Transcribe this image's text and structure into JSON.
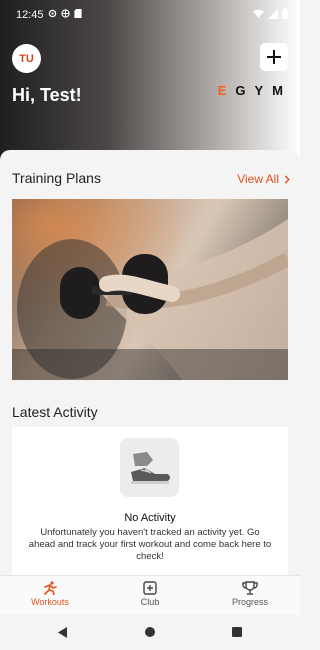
{
  "status_bar": {
    "time": "12:45"
  },
  "header": {
    "avatar_initials": "TU",
    "greeting": "Hi, Test!",
    "brand": [
      "E",
      "G",
      "Y",
      "M"
    ]
  },
  "training_plans": {
    "title": "Training Plans",
    "view_all": "View All"
  },
  "latest_activity": {
    "title": "Latest Activity",
    "empty_title": "No Activity",
    "empty_description": "Unfortunately you haven't tracked an activity yet. Go ahead and track your first workout and come back here to check!"
  },
  "bottom_nav": {
    "items": [
      {
        "label": "Workouts",
        "icon": "running-person-icon",
        "active": true
      },
      {
        "label": "Club",
        "icon": "club-icon",
        "active": false
      },
      {
        "label": "Progress",
        "icon": "trophy-icon",
        "active": false
      }
    ]
  },
  "colors": {
    "accent": "#e0531f",
    "brand_orange": "#f26322"
  }
}
